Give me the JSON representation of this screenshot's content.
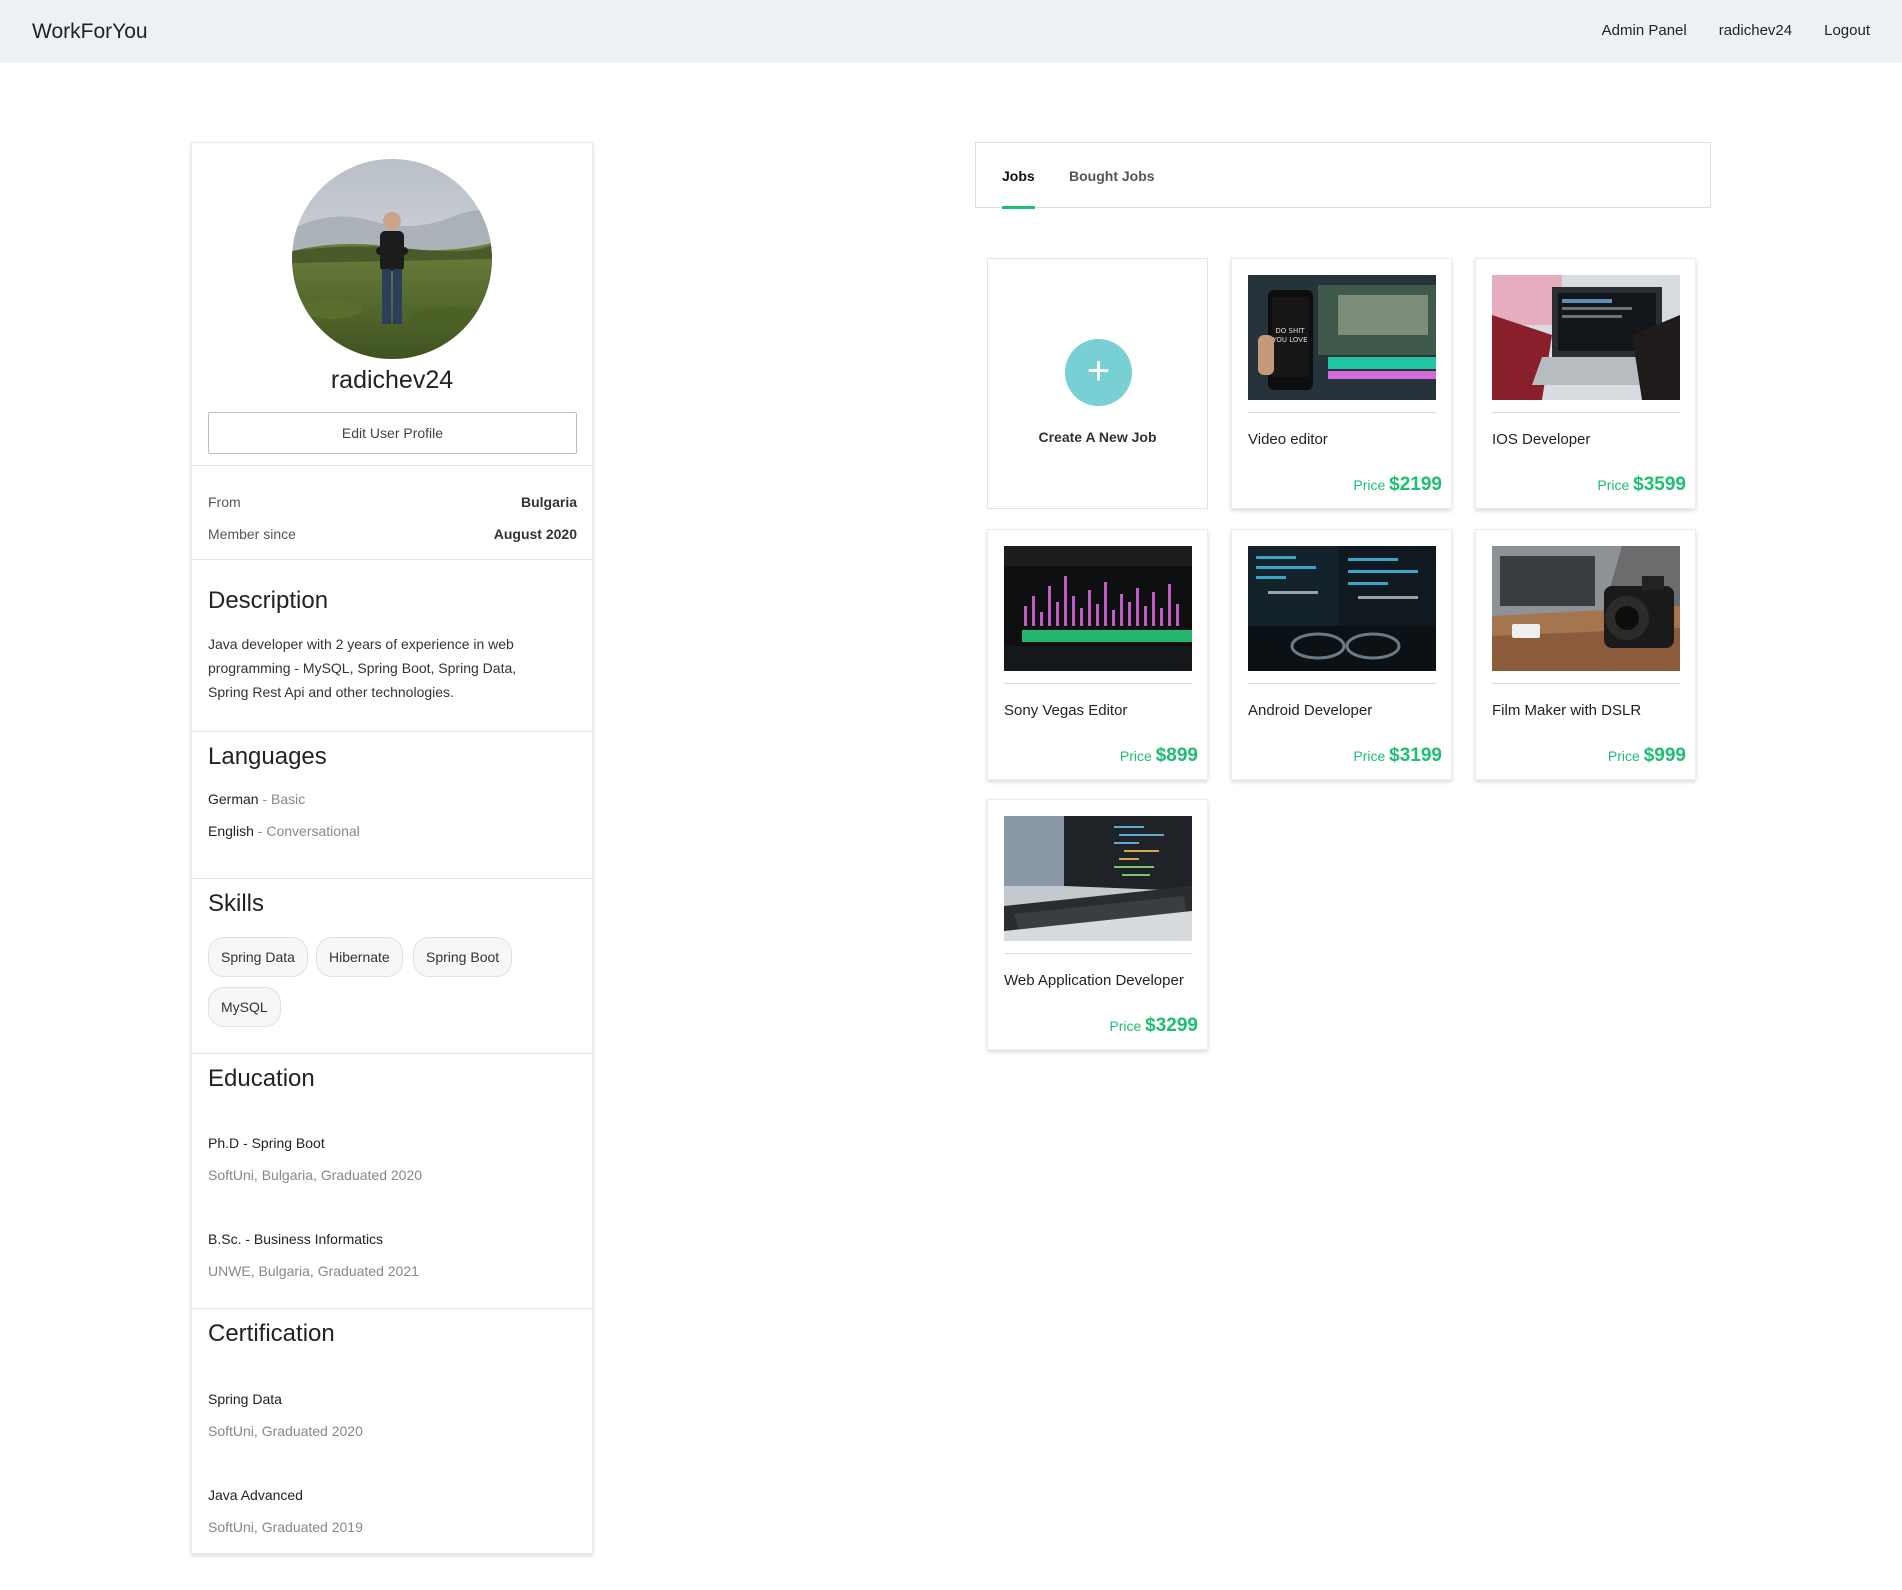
{
  "navbar": {
    "brand": "WorkForYou",
    "links": [
      "Admin Panel",
      "radichev24",
      "Logout"
    ]
  },
  "profile": {
    "username": "radichev24",
    "edit_button": "Edit User Profile",
    "from_label": "From",
    "from_value": "Bulgaria",
    "member_label": "Member since",
    "member_value": "August 2020",
    "description_title": "Description",
    "description_text": "Java developer with 2 years of experience in web programming - MySQL, Spring Boot, Spring Data, Spring Rest Api and other technologies.",
    "languages_title": "Languages",
    "languages": [
      {
        "name": "German",
        "level": " - Basic"
      },
      {
        "name": "English",
        "level": " - Conversational"
      }
    ],
    "skills_title": "Skills",
    "skills": [
      "Spring Data",
      "Hibernate",
      "Spring Boot",
      "MySQL"
    ],
    "education_title": "Education",
    "education": [
      {
        "title": "Ph.D - Spring Boot",
        "sub": "SoftUni, Bulgaria, Graduated 2020"
      },
      {
        "title": "B.Sc. - Business Informatics",
        "sub": "UNWE, Bulgaria, Graduated 2021"
      }
    ],
    "certification_title": "Certification",
    "certifications": [
      {
        "title": "Spring Data",
        "sub": "SoftUni, Graduated 2020"
      },
      {
        "title": "Java Advanced",
        "sub": "SoftUni, Graduated 2019"
      }
    ]
  },
  "tabs": {
    "items": [
      "Jobs",
      "Bought Jobs"
    ],
    "active": "Jobs"
  },
  "create_job": {
    "label": "Create A New Job"
  },
  "jobs": [
    {
      "title": "Video editor",
      "price_label": "Price",
      "price": "$2199",
      "icon": "phone-video-editing-image"
    },
    {
      "title": "IOS Developer",
      "price_label": "Price",
      "price": "$3599",
      "icon": "laptop-coding-image"
    },
    {
      "title": "Sony Vegas Editor",
      "price_label": "Price",
      "price": "$899",
      "icon": "audio-waveform-image"
    },
    {
      "title": "Android Developer",
      "price_label": "Price",
      "price": "$3199",
      "icon": "code-screen-glasses-image"
    },
    {
      "title": "Film Maker with DSLR",
      "price_label": "Price",
      "price": "$999",
      "icon": "dslr-camera-laptop-image"
    },
    {
      "title": "Web Application Developer",
      "price_label": "Price",
      "price": "$3299",
      "icon": "macbook-code-image"
    }
  ],
  "colors": {
    "accent": "#1dbf73",
    "create_circle": "#79d0d4",
    "navbar_bg": "#eef1f4"
  }
}
